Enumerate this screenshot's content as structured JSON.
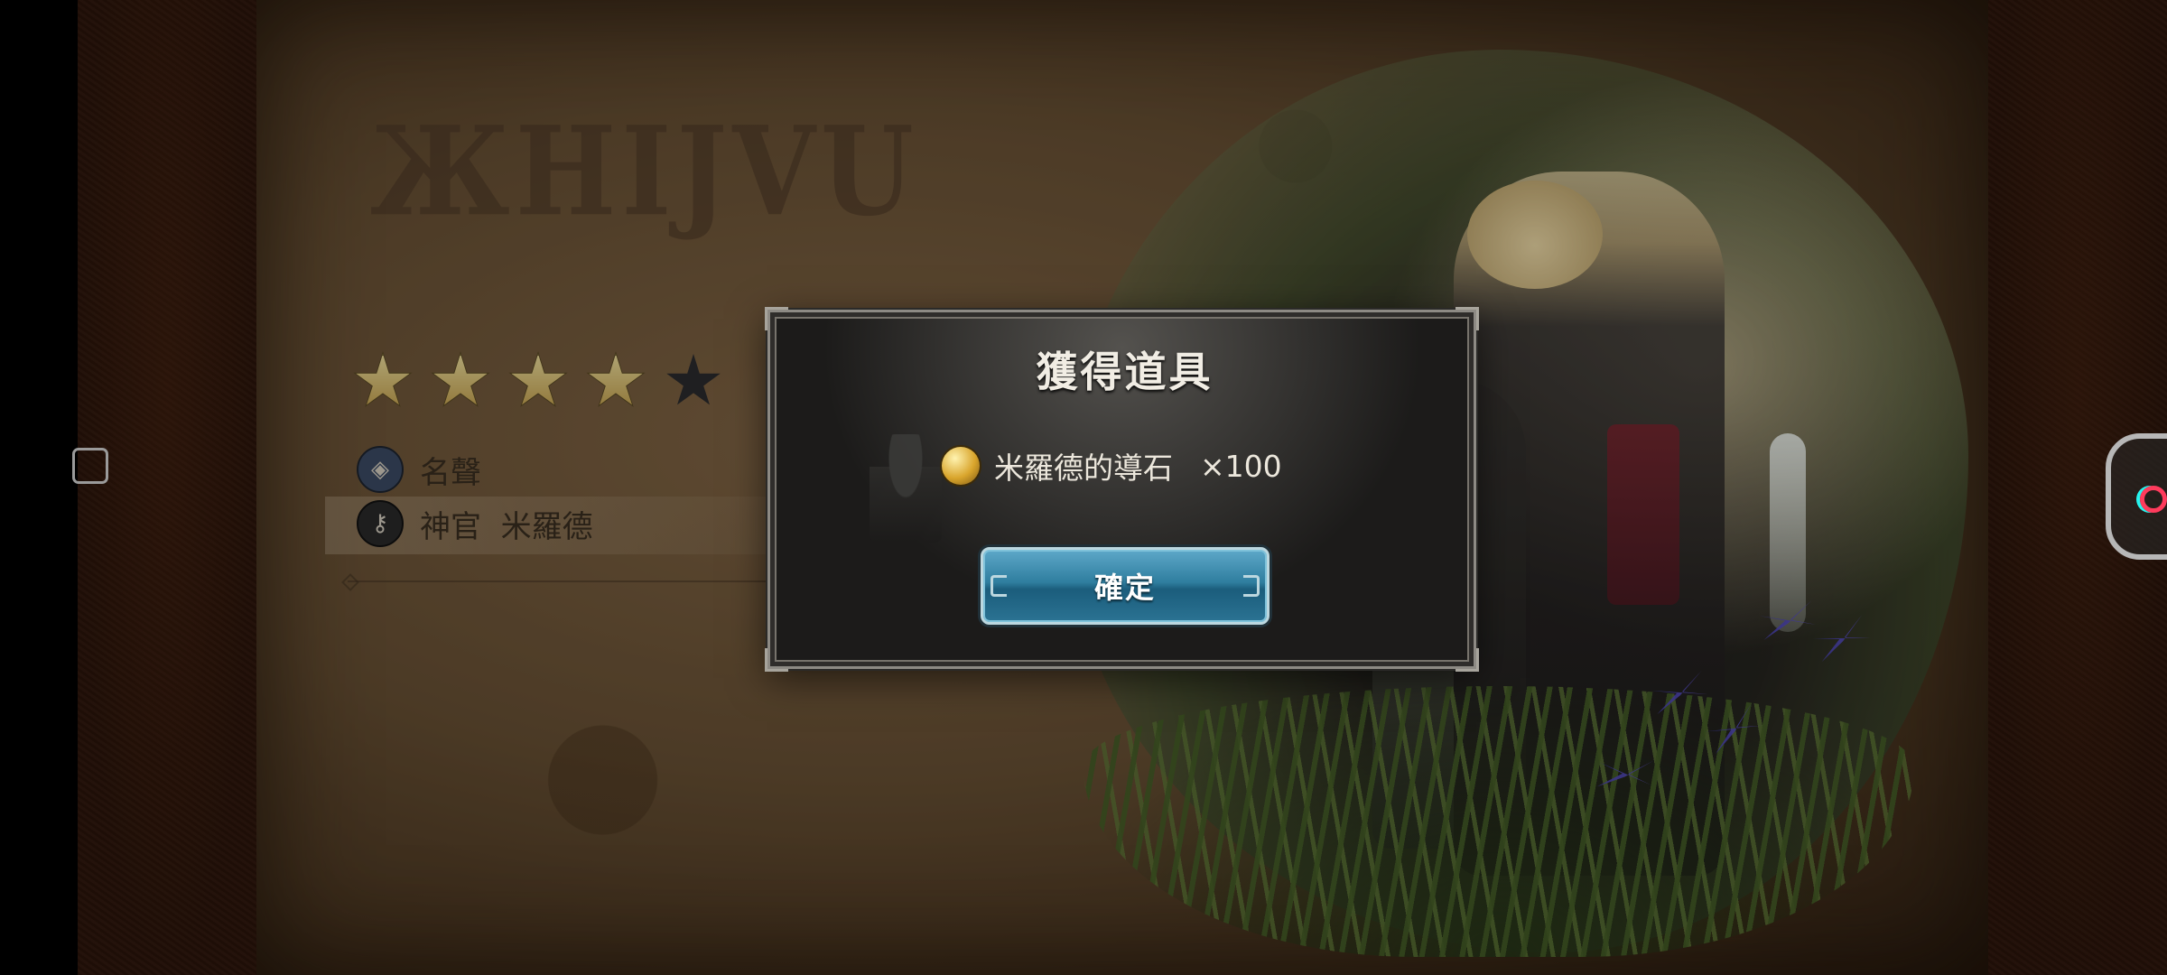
{
  "page": {
    "gothic_title": "ЖНIJVU"
  },
  "rating": {
    "total": 5,
    "filled": 4
  },
  "profile": {
    "fame_label": "名聲",
    "title_label": "神官  米羅德"
  },
  "dialog": {
    "title": "獲得道具",
    "item_name": "米羅德的導石",
    "item_quantity": "×100",
    "confirm_label": "確定"
  },
  "icons": {
    "fame": "fame-emblem-icon",
    "title": "key-icon",
    "item": "guide-stone-icon"
  },
  "colors": {
    "confirm_button": "#2f7e9f",
    "star_filled": "#e0c77a",
    "star_empty": "#2c2b2e"
  }
}
